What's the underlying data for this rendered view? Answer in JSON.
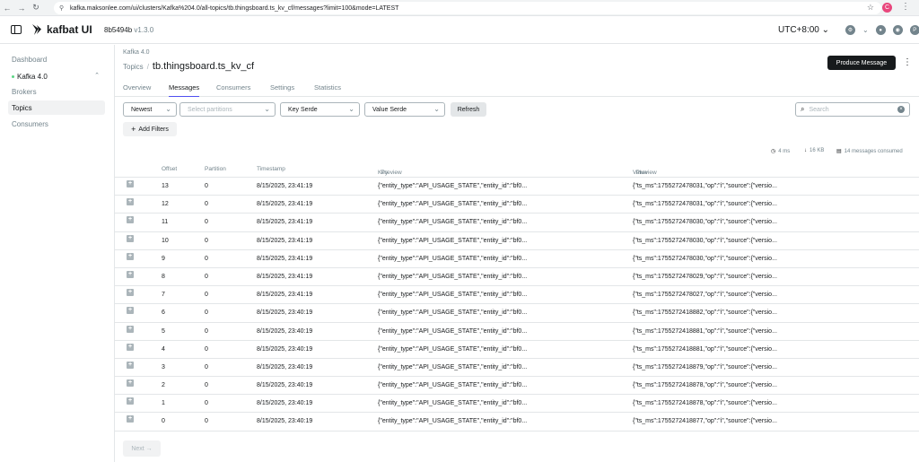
{
  "browser": {
    "url": "kafka.maksonlee.com/ui/clusters/Kafka%204.0/all-topics/tb.thingsboard.ts_kv_cf/messages?limit=100&mode=LATEST",
    "profile_initial": "C"
  },
  "header": {
    "logo": "kafbat UI",
    "commit": "8b5494b",
    "version": "v1.3.0",
    "timezone": "UTC+8:00"
  },
  "sidebar": {
    "dashboard": "Dashboard",
    "cluster": "Kafka 4.0",
    "items": [
      "Brokers",
      "Topics",
      "Consumers"
    ]
  },
  "page": {
    "cluster_label": "Kafka 4.0",
    "breadcrumb_parent": "Topics",
    "topic": "tb.thingsboard.ts_kv_cf",
    "produce_label": "Produce Message"
  },
  "tabs": [
    "Overview",
    "Messages",
    "Consumers",
    "Settings",
    "Statistics"
  ],
  "filters": {
    "mode": "Newest",
    "partitions_placeholder": "Select partitions",
    "key_serde": "Key Serde",
    "value_serde": "Value Serde",
    "refresh": "Refresh",
    "search_placeholder": "Search",
    "add_filters": "Add Filters"
  },
  "meta": {
    "duration": "4 ms",
    "bytes": "16 KB",
    "consumed": "14 messages consumed"
  },
  "table": {
    "headers": {
      "offset": "Offset",
      "partition": "Partition",
      "timestamp": "Timestamp",
      "key": "Key",
      "key_preview": "Preview",
      "value": "Value",
      "value_preview": "Preview"
    },
    "rows": [
      {
        "offset": "13",
        "partition": "0",
        "timestamp": "8/15/2025, 23:41:19",
        "key": "{\"entity_type\":\"API_USAGE_STATE\",\"entity_id\":\"bf0...",
        "value": "{\"ts_ms\":1755272478031,\"op\":\"i\",\"source\":{\"versio..."
      },
      {
        "offset": "12",
        "partition": "0",
        "timestamp": "8/15/2025, 23:41:19",
        "key": "{\"entity_type\":\"API_USAGE_STATE\",\"entity_id\":\"bf0...",
        "value": "{\"ts_ms\":1755272478031,\"op\":\"i\",\"source\":{\"versio..."
      },
      {
        "offset": "11",
        "partition": "0",
        "timestamp": "8/15/2025, 23:41:19",
        "key": "{\"entity_type\":\"API_USAGE_STATE\",\"entity_id\":\"bf0...",
        "value": "{\"ts_ms\":1755272478030,\"op\":\"i\",\"source\":{\"versio..."
      },
      {
        "offset": "10",
        "partition": "0",
        "timestamp": "8/15/2025, 23:41:19",
        "key": "{\"entity_type\":\"API_USAGE_STATE\",\"entity_id\":\"bf0...",
        "value": "{\"ts_ms\":1755272478030,\"op\":\"i\",\"source\":{\"versio..."
      },
      {
        "offset": "9",
        "partition": "0",
        "timestamp": "8/15/2025, 23:41:19",
        "key": "{\"entity_type\":\"API_USAGE_STATE\",\"entity_id\":\"bf0...",
        "value": "{\"ts_ms\":1755272478030,\"op\":\"i\",\"source\":{\"versio..."
      },
      {
        "offset": "8",
        "partition": "0",
        "timestamp": "8/15/2025, 23:41:19",
        "key": "{\"entity_type\":\"API_USAGE_STATE\",\"entity_id\":\"bf0...",
        "value": "{\"ts_ms\":1755272478029,\"op\":\"i\",\"source\":{\"versio..."
      },
      {
        "offset": "7",
        "partition": "0",
        "timestamp": "8/15/2025, 23:41:19",
        "key": "{\"entity_type\":\"API_USAGE_STATE\",\"entity_id\":\"bf0...",
        "value": "{\"ts_ms\":1755272478027,\"op\":\"i\",\"source\":{\"versio..."
      },
      {
        "offset": "6",
        "partition": "0",
        "timestamp": "8/15/2025, 23:40:19",
        "key": "{\"entity_type\":\"API_USAGE_STATE\",\"entity_id\":\"bf0...",
        "value": "{\"ts_ms\":1755272418882,\"op\":\"i\",\"source\":{\"versio..."
      },
      {
        "offset": "5",
        "partition": "0",
        "timestamp": "8/15/2025, 23:40:19",
        "key": "{\"entity_type\":\"API_USAGE_STATE\",\"entity_id\":\"bf0...",
        "value": "{\"ts_ms\":1755272418881,\"op\":\"i\",\"source\":{\"versio..."
      },
      {
        "offset": "4",
        "partition": "0",
        "timestamp": "8/15/2025, 23:40:19",
        "key": "{\"entity_type\":\"API_USAGE_STATE\",\"entity_id\":\"bf0...",
        "value": "{\"ts_ms\":1755272418881,\"op\":\"i\",\"source\":{\"versio..."
      },
      {
        "offset": "3",
        "partition": "0",
        "timestamp": "8/15/2025, 23:40:19",
        "key": "{\"entity_type\":\"API_USAGE_STATE\",\"entity_id\":\"bf0...",
        "value": "{\"ts_ms\":1755272418879,\"op\":\"i\",\"source\":{\"versio..."
      },
      {
        "offset": "2",
        "partition": "0",
        "timestamp": "8/15/2025, 23:40:19",
        "key": "{\"entity_type\":\"API_USAGE_STATE\",\"entity_id\":\"bf0...",
        "value": "{\"ts_ms\":1755272418878,\"op\":\"i\",\"source\":{\"versio..."
      },
      {
        "offset": "1",
        "partition": "0",
        "timestamp": "8/15/2025, 23:40:19",
        "key": "{\"entity_type\":\"API_USAGE_STATE\",\"entity_id\":\"bf0...",
        "value": "{\"ts_ms\":1755272418878,\"op\":\"i\",\"source\":{\"versio..."
      },
      {
        "offset": "0",
        "partition": "0",
        "timestamp": "8/15/2025, 23:40:19",
        "key": "{\"entity_type\":\"API_USAGE_STATE\",\"entity_id\":\"bf0...",
        "value": "{\"ts_ms\":1755272418877,\"op\":\"i\",\"source\":{\"versio..."
      }
    ]
  },
  "pagination": {
    "next": "Next →"
  },
  "colors": {
    "accent": "#4f4ff0",
    "dark_button": "#171a1c",
    "online_dot": "#5cd685"
  }
}
